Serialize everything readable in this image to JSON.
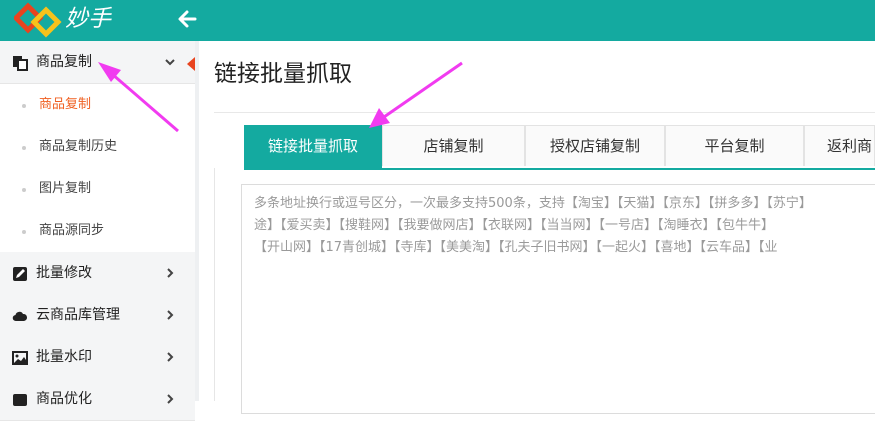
{
  "app": {
    "brand": "妙手",
    "accent_color": "#14aaa0",
    "active_color": "#f06022",
    "annotation_color": "#f13bf0"
  },
  "header": {
    "back_icon": "arrow-left-icon"
  },
  "sidebar": {
    "groups": [
      {
        "label": "商品复制",
        "icon": "copy-icon",
        "expanded": true,
        "items": [
          {
            "label": "商品复制",
            "active": true
          },
          {
            "label": "商品复制历史"
          },
          {
            "label": "图片复制"
          },
          {
            "label": "商品源同步"
          }
        ]
      },
      {
        "label": "批量修改",
        "icon": "edit-icon"
      },
      {
        "label": "云商品库管理",
        "icon": "cloud-icon"
      },
      {
        "label": "批量水印",
        "icon": "image-icon"
      },
      {
        "label": "商品优化",
        "icon": "optimize-icon"
      }
    ]
  },
  "main": {
    "title": "链接批量抓取",
    "tabs": [
      "链接批量抓取",
      "店铺复制",
      "授权店铺复制",
      "平台复制",
      "返利商"
    ],
    "active_tab": 0,
    "textarea": {
      "placeholder_lines": [
        "多条地址换行或逗号区分，一次最多支持500条，支持【淘宝】【天猫】【京东】【拼多多】【苏宁】",
        "途】【爱买卖】【搜鞋网】【我要做网店】【衣联网】【当当网】【一号店】【淘睡衣】【包牛牛】",
        "【开山网】【17青创城】【寺库】【美美淘】【孔夫子旧书网】【一起火】【喜地】【云车品】【业"
      ]
    }
  }
}
